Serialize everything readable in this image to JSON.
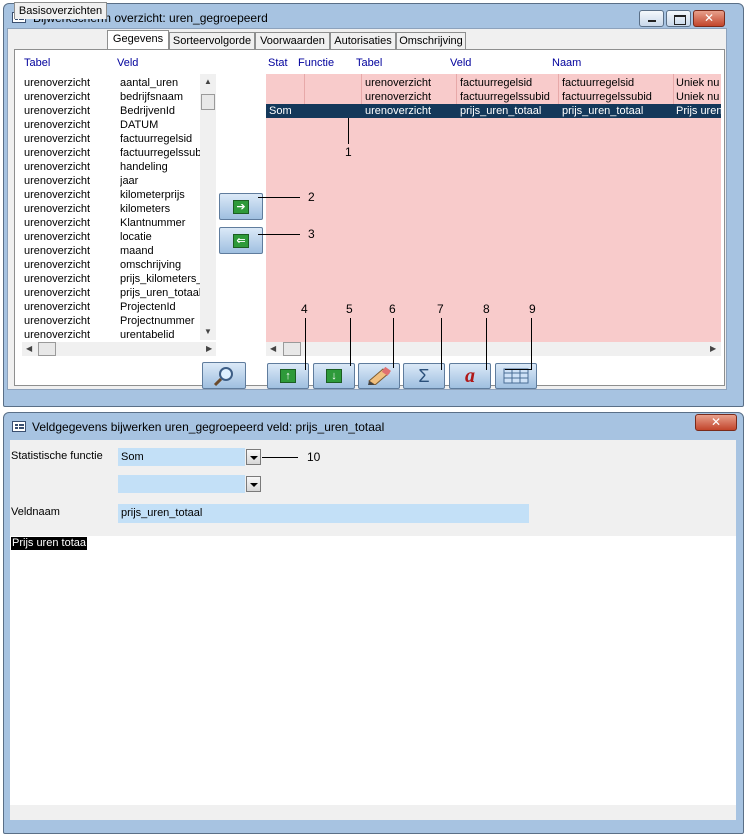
{
  "window1": {
    "title": "Bijwerkscherm overzicht: uren_gegroepeerd",
    "tabs": [
      {
        "label": "Basisoverzichten",
        "active": false
      },
      {
        "label": "Gegevens",
        "active": true
      },
      {
        "label": "Sorteervolgorde",
        "active": false
      },
      {
        "label": "Voorwaarden",
        "active": false
      },
      {
        "label": "Autorisaties",
        "active": false
      },
      {
        "label": "Omschrijving",
        "active": false
      }
    ],
    "left_list": {
      "header_table": "Tabel",
      "header_field": "Veld",
      "rows": [
        {
          "table": "urenoverzicht",
          "field": "aantal_uren"
        },
        {
          "table": "urenoverzicht",
          "field": "bedrijfsnaam"
        },
        {
          "table": "urenoverzicht",
          "field": "BedrijvenId"
        },
        {
          "table": "urenoverzicht",
          "field": "DATUM"
        },
        {
          "table": "urenoverzicht",
          "field": "factuurregelsid"
        },
        {
          "table": "urenoverzicht",
          "field": "factuurregelssubid"
        },
        {
          "table": "urenoverzicht",
          "field": "handeling"
        },
        {
          "table": "urenoverzicht",
          "field": "jaar"
        },
        {
          "table": "urenoverzicht",
          "field": "kilometerprijs"
        },
        {
          "table": "urenoverzicht",
          "field": "kilometers"
        },
        {
          "table": "urenoverzicht",
          "field": "Klantnummer"
        },
        {
          "table": "urenoverzicht",
          "field": "locatie"
        },
        {
          "table": "urenoverzicht",
          "field": "maand"
        },
        {
          "table": "urenoverzicht",
          "field": "omschrijving"
        },
        {
          "table": "urenoverzicht",
          "field": "prijs_kilometers_t"
        },
        {
          "table": "urenoverzicht",
          "field": "prijs_uren_totaal"
        },
        {
          "table": "urenoverzicht",
          "field": "ProjectenId"
        },
        {
          "table": "urenoverzicht",
          "field": "Projectnummer"
        },
        {
          "table": "urenoverzicht",
          "field": "urentabelid"
        }
      ]
    },
    "right_grid": {
      "headers": [
        "Stat",
        "Functie",
        "Tabel",
        "Veld",
        "Naam"
      ],
      "rows": [
        {
          "stat": "",
          "functie": "",
          "tabel": "urenoverzicht",
          "veld": "factuurregelsid",
          "naam": "factuurregelsid",
          "extra": "Uniek nu",
          "selected": false
        },
        {
          "stat": "",
          "functie": "",
          "tabel": "urenoverzicht",
          "veld": "factuurregelssubid",
          "naam": "factuurregelssubid",
          "extra": "Uniek nu",
          "selected": false
        },
        {
          "stat": "Som",
          "functie": "",
          "tabel": "urenoverzicht",
          "veld": "prijs_uren_totaal",
          "naam": "prijs_uren_totaal",
          "extra": "Prijs uren",
          "selected": true
        }
      ]
    },
    "callouts": [
      "1",
      "2",
      "3",
      "4",
      "5",
      "6",
      "7",
      "8",
      "9"
    ],
    "buttons": {
      "add": "arrow-right-icon",
      "remove": "arrow-left-icon",
      "search": "magnifier-icon",
      "move_up": "arrow-up-icon",
      "move_down": "arrow-down-icon",
      "edit": "pencil-icon",
      "sum": "sigma-icon",
      "format": "font-a-icon",
      "table": "table-icon"
    }
  },
  "window2": {
    "title": "Veldgegevens bijwerken uren_gegroepeerd veld: prijs_uren_totaal",
    "stat_label": "Statistische functie",
    "stat_value": "Som",
    "second_combo_value": "",
    "fieldname_label": "Veldnaam",
    "fieldname_value": "prijs_uren_totaal",
    "description_text": "Prijs uren totaa",
    "callout": "10"
  },
  "colors": {
    "title_bar": "#a7c3e1",
    "grid_background": "#f8cbcb",
    "grid_selected": "#14385a",
    "input_background": "#c3e0f7"
  }
}
